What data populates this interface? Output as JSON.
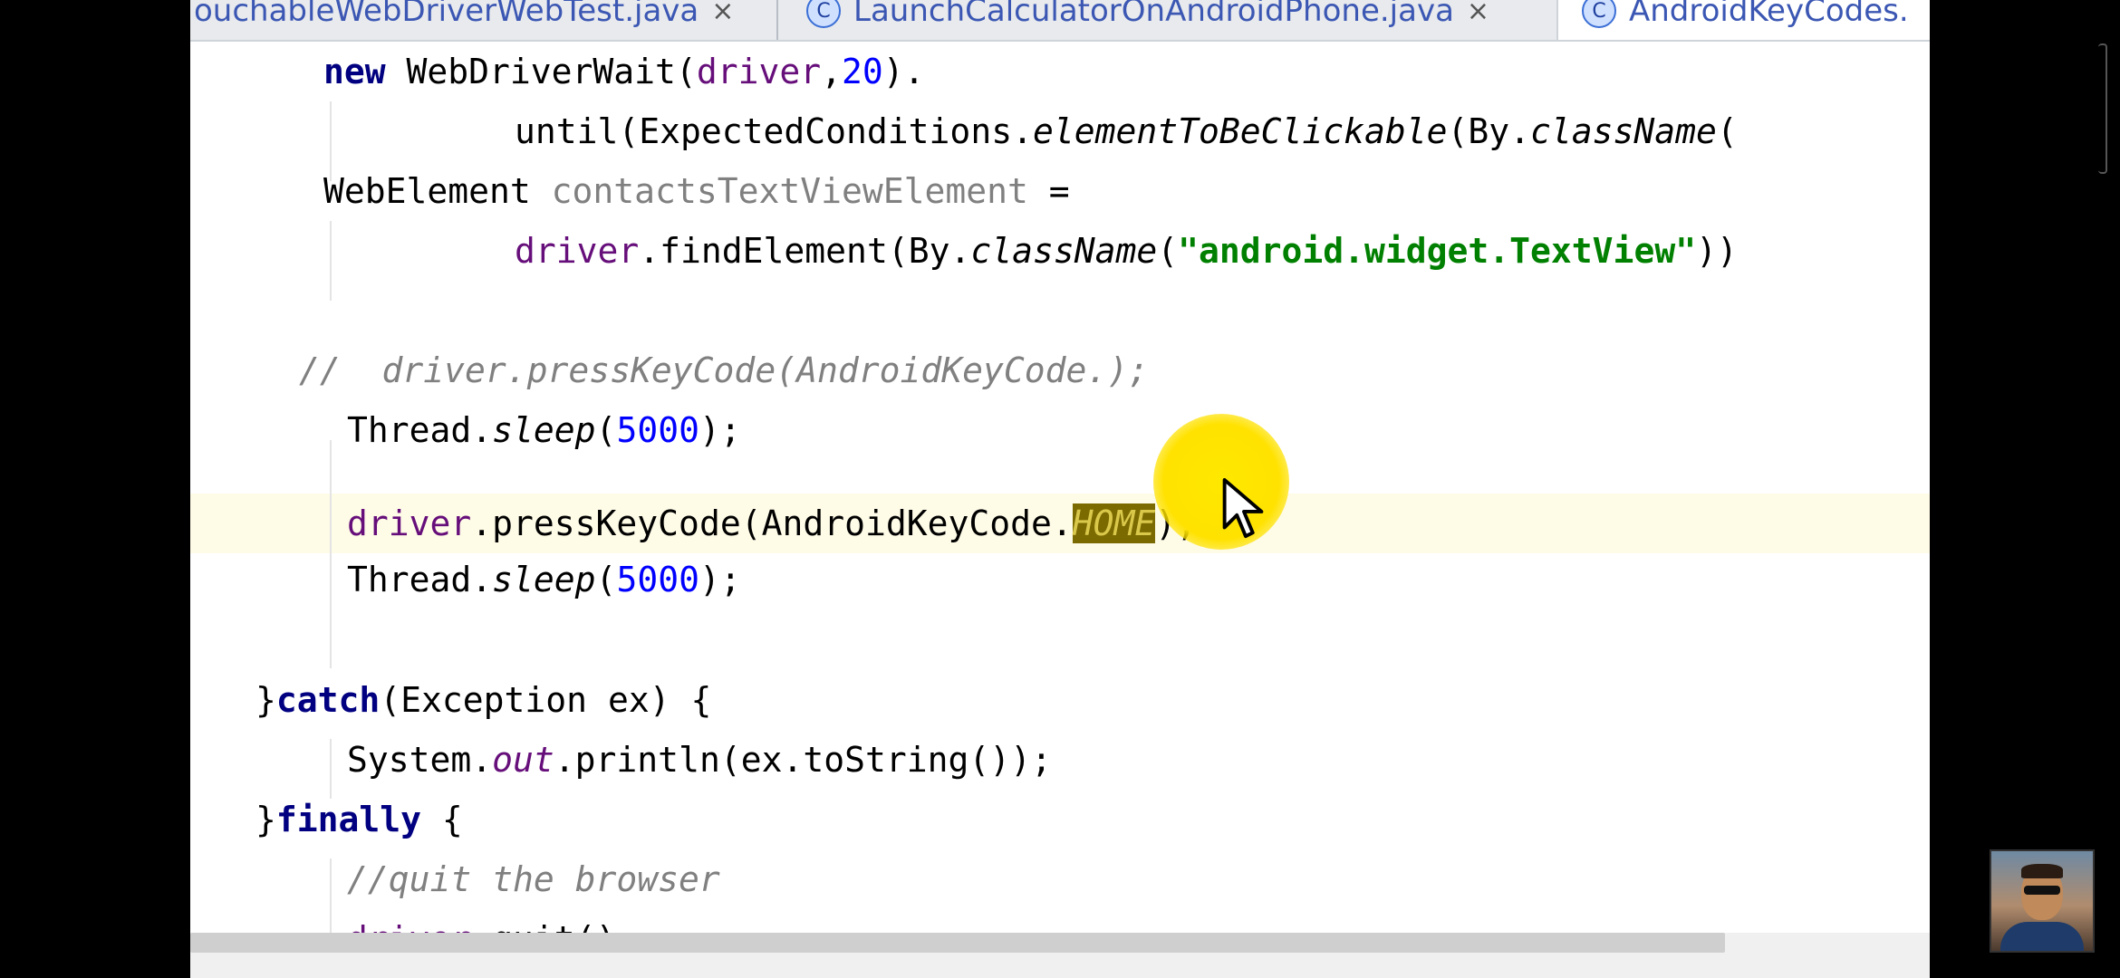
{
  "tabs": [
    {
      "label": "ouchableWebDriverWebTest.java",
      "close": "×"
    },
    {
      "label": "LaunchCalculatorOnAndroidPhone.java",
      "close": "×"
    },
    {
      "label": "AndroidKeyCodes."
    }
  ],
  "code": {
    "l1": {
      "a": "new",
      "b": " WebDriverWait(",
      "c": "driver",
      "d": ",",
      "e": "20",
      "f": ")."
    },
    "l2": {
      "a": "until(ExpectedConditions.",
      "b": "elementToBeClickable",
      "c": "(By.",
      "d": "className",
      "e": "("
    },
    "l3": {
      "a": "WebElement ",
      "b": "contactsTextViewElement",
      "c": " ="
    },
    "l4": {
      "a": "driver",
      "b": ".findElement(By.",
      "c": "className",
      "d": "(",
      "e": "\"android.widget.TextView\"",
      "f": "))"
    },
    "l5": {
      "a": "//  driver.pressKeyCode(AndroidKeyCode.);"
    },
    "l6": {
      "a": "Thread.",
      "b": "sleep",
      "c": "(",
      "d": "5000",
      "e": ");"
    },
    "l7": {
      "a": "driver",
      "b": ".pressKeyCode(AndroidKeyCode.",
      "c": "HOME",
      "d": ");"
    },
    "l8": {
      "a": "Thread.",
      "b": "sleep",
      "c": "(",
      "d": "5000",
      "e": ");"
    },
    "l9": {
      "a": "}",
      "b": "catch",
      "c": "(Exception ex) {"
    },
    "l10": {
      "a": "System.",
      "b": "out",
      "c": ".println(ex.toString());"
    },
    "l11": {
      "a": "}",
      "b": "finally",
      "c": " {"
    },
    "l12": {
      "a": "//quit the browser"
    },
    "l13": {
      "a": "driver",
      "b": ".quit();"
    }
  },
  "colors": {
    "keyword": "#000080",
    "number": "#0000ff",
    "string": "#008000",
    "field": "#660e7a",
    "comment": "#808080",
    "current_line": "#fefbe7",
    "click_highlight": "#ffe800"
  },
  "icons": {
    "tab_class_icon": "class-c-icon",
    "cursor": "mouse-pointer-icon"
  }
}
